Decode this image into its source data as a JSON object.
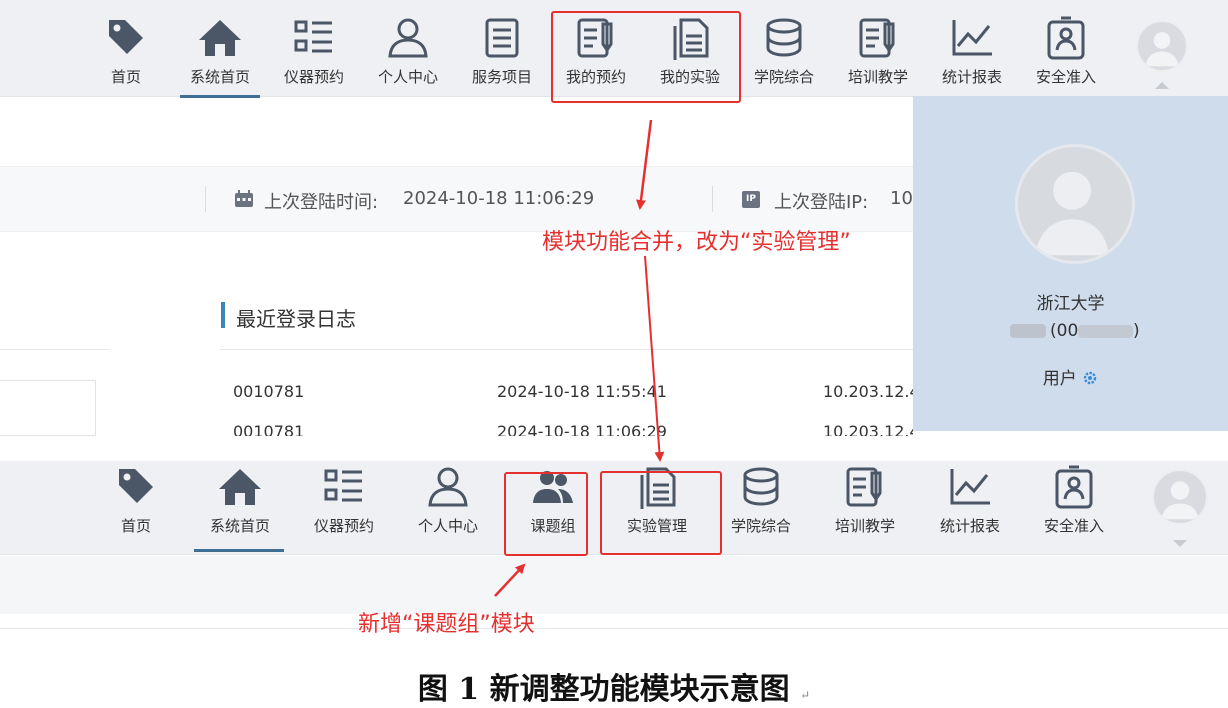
{
  "nav_before": {
    "items": [
      {
        "label": "首页",
        "icon": "tag-icon"
      },
      {
        "label": "系统首页",
        "icon": "home-icon"
      },
      {
        "label": "仪器预约",
        "icon": "list-icon"
      },
      {
        "label": "个人中心",
        "icon": "user-icon"
      },
      {
        "label": "服务项目",
        "icon": "document-icon"
      },
      {
        "label": "我的预约",
        "icon": "edit-doc-icon"
      },
      {
        "label": "我的实验",
        "icon": "files-icon"
      },
      {
        "label": "学院综合",
        "icon": "database-icon"
      },
      {
        "label": "培训教学",
        "icon": "edit-doc-icon"
      },
      {
        "label": "统计报表",
        "icon": "chart-line-icon"
      },
      {
        "label": "安全准入",
        "icon": "badge-icon"
      }
    ],
    "active": "系统首页"
  },
  "page_before": {
    "last_login_time_label": "上次登陆时间:",
    "last_login_time": "2024-10-18 11:06:29",
    "last_login_ip_label": "上次登陆IP:",
    "last_login_ip": "10",
    "log_title": "最近登录日志",
    "log_rows": [
      {
        "user": "0010781",
        "time": "2024-10-18 11:55:41",
        "ip": "10.203.12.4"
      },
      {
        "user": "0010781",
        "time": "2024-10-18 11:06:29",
        "ip": "10.203.12.4"
      }
    ]
  },
  "user_menu": {
    "org": "浙江大学",
    "id_text": "(00",
    "id_text_end": ")",
    "role": "用户"
  },
  "nav_after": {
    "items": [
      {
        "label": "首页",
        "icon": "tag-icon"
      },
      {
        "label": "系统首页",
        "icon": "home-icon"
      },
      {
        "label": "仪器预约",
        "icon": "list-icon"
      },
      {
        "label": "个人中心",
        "icon": "user-icon"
      },
      {
        "label": "课题组",
        "icon": "group-icon"
      },
      {
        "label": "实验管理",
        "icon": "files-icon"
      },
      {
        "label": "学院综合",
        "icon": "database-icon"
      },
      {
        "label": "培训教学",
        "icon": "edit-doc-icon"
      },
      {
        "label": "统计报表",
        "icon": "chart-line-icon"
      },
      {
        "label": "安全准入",
        "icon": "badge-icon"
      }
    ],
    "active": "系统首页"
  },
  "annotations": {
    "merge_note": "模块功能合并，改为“实验管理”",
    "new_note": "新增“课题组”模块",
    "color": "#e53030"
  },
  "caption": "图 1  新调整功能模块示意图",
  "caption_mark": "↵"
}
